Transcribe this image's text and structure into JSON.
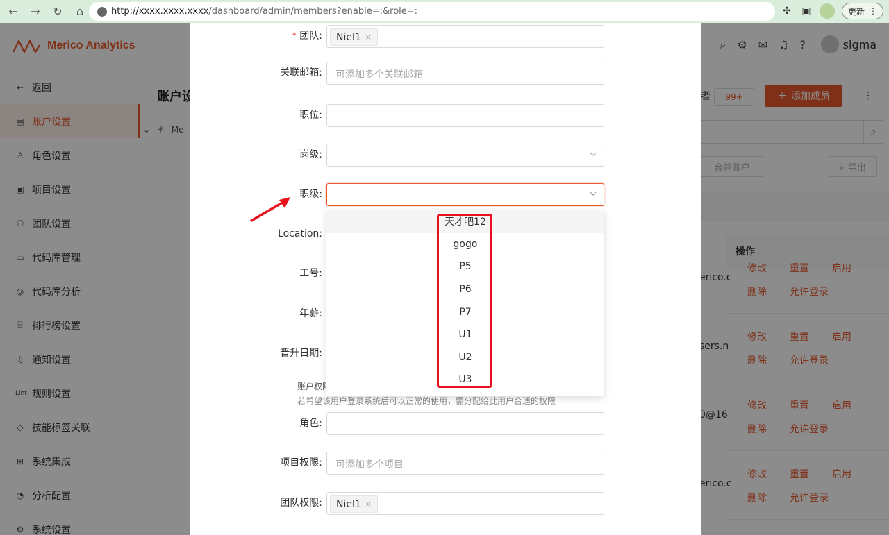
{
  "browser": {
    "url_host": "http://xxxx.xxxx.xxxx",
    "url_path": "/dashboard/admin/members?enable=:&role=:",
    "update_label": "更新"
  },
  "app": {
    "brand": "Merico Analytics",
    "user_name": "sigma",
    "page_title": "账户设",
    "tree_root": "Me",
    "pending_label": "者",
    "pending_count": "99+",
    "add_member": "添加成员",
    "merge_accounts": "合并账户",
    "export": "导出",
    "table_ops_header": "操作"
  },
  "sidebar": {
    "items": [
      {
        "label": "返回",
        "icon": "arrow-left-icon",
        "glyph": "←"
      },
      {
        "label": "账户设置",
        "icon": "account-icon",
        "glyph": "▤",
        "active": true
      },
      {
        "label": "角色设置",
        "icon": "role-icon",
        "glyph": "♙"
      },
      {
        "label": "项目设置",
        "icon": "project-icon",
        "glyph": "▣"
      },
      {
        "label": "团队设置",
        "icon": "team-icon",
        "glyph": "⚇"
      },
      {
        "label": "代码库管理",
        "icon": "repo-icon",
        "glyph": "▭"
      },
      {
        "label": "代码库分析",
        "icon": "analysis-icon",
        "glyph": "◎"
      },
      {
        "label": "排行榜设置",
        "icon": "leaderboard-icon",
        "glyph": "⌸"
      },
      {
        "label": "通知设置",
        "icon": "bell-icon",
        "glyph": "♫"
      },
      {
        "label": "规则设置",
        "icon": "lint-icon",
        "glyph": "Lint"
      },
      {
        "label": "技能标签关联",
        "icon": "tag-icon",
        "glyph": "◇"
      },
      {
        "label": "系统集成",
        "icon": "integration-icon",
        "glyph": "⊞"
      },
      {
        "label": "分析配置",
        "icon": "config-icon",
        "glyph": "◔"
      },
      {
        "label": "系统设置",
        "icon": "settings-icon",
        "glyph": "⚙"
      }
    ]
  },
  "table": {
    "rows": [
      {
        "email": "erico.c",
        "ops": [
          "修改",
          "重置",
          "启用",
          "删除",
          "允许登录"
        ]
      },
      {
        "email": "sers.n",
        "ops": [
          "修改",
          "重置",
          "启用",
          "删除",
          "允许登录"
        ]
      },
      {
        "email": "0@16",
        "ops": [
          "修改",
          "重置",
          "启用",
          "删除",
          "允许登录"
        ]
      },
      {
        "email": "erico.c",
        "ops": [
          "修改",
          "重置",
          "启用",
          "删除",
          "允许登录"
        ]
      }
    ]
  },
  "form": {
    "team": {
      "label": "团队",
      "tag": "Niel1"
    },
    "emails": {
      "label": "关联邮箱",
      "placeholder": "可添加多个关联邮箱"
    },
    "position": {
      "label": "职位"
    },
    "post_level": {
      "label": "岗级"
    },
    "rank": {
      "label": "职级"
    },
    "location": {
      "label": "Location"
    },
    "employee_id": {
      "label": "工号"
    },
    "salary": {
      "label": "年薪"
    },
    "promotion_date": {
      "label": "晋升日期"
    },
    "perm_title": "账户权限",
    "perm_note": "若希望该用户登录系统后可以正常的使用，需分配给此用户合适的权限",
    "role": {
      "label": "角色"
    },
    "project_perm": {
      "label": "项目权限",
      "placeholder": "可添加多个项目"
    },
    "team_perm": {
      "label": "团队权限",
      "tag": "Niel1"
    }
  },
  "rank_options": [
    "天才吧12",
    "gogo",
    "P5",
    "P6",
    "P7",
    "U1",
    "U2",
    "U3"
  ],
  "colors": {
    "brand": "#e8582c",
    "annotation": "#e8111c"
  }
}
